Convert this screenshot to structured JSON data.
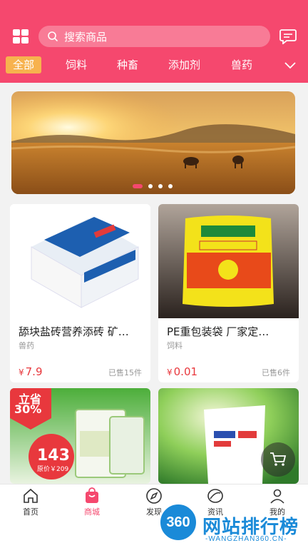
{
  "header": {
    "search_placeholder": "搜索商品",
    "brand_color": "#f5486e"
  },
  "categories": [
    {
      "label": "全部",
      "active": true
    },
    {
      "label": "饲料"
    },
    {
      "label": "种畜"
    },
    {
      "label": "添加剂"
    },
    {
      "label": "兽药"
    }
  ],
  "banner": {
    "dots": 4,
    "active_dot": 0
  },
  "products": [
    {
      "title": "舔块盐砖营养添砖 矿…",
      "category": "兽药",
      "currency": "¥",
      "price": "7.9",
      "sold": "已售15件"
    },
    {
      "title": "PE重包装袋 厂家定…",
      "category": "饲料",
      "currency": "¥",
      "price": "0.01",
      "sold": "已售6件"
    },
    {
      "badge": "立省",
      "badge_pct": "30%",
      "promo_price": "143",
      "promo_orig": "原价￥209"
    },
    {}
  ],
  "tabbar": [
    {
      "label": "首页",
      "icon": "home-icon"
    },
    {
      "label": "商城",
      "icon": "shop-bag-icon",
      "active": true
    },
    {
      "label": "发现",
      "icon": "compass-icon"
    },
    {
      "label": "资讯",
      "icon": "news-icon"
    },
    {
      "label": "我的",
      "icon": "user-icon"
    }
  ],
  "watermark": {
    "logo": "360",
    "title": "网站排行榜",
    "sub": "-WANGZHAN360.CN-"
  }
}
